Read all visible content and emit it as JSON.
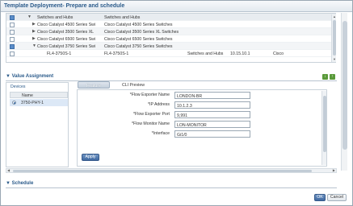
{
  "dialog": {
    "title": "Template Deployment- Prepare and schedule"
  },
  "tree": {
    "rows": [
      {
        "checked": true,
        "expanded": true,
        "indent": 1,
        "name": "Switches and Hubs",
        "type": "Switches and Hubs",
        "category": "",
        "ip": "",
        "vendor": ""
      },
      {
        "checked": false,
        "expanded": false,
        "indent": 2,
        "name": "Cisco Catalyst 4500 Series Swi",
        "type": "Cisco Catalyst 4500 Series Switches",
        "category": "",
        "ip": "",
        "vendor": ""
      },
      {
        "checked": false,
        "expanded": false,
        "indent": 2,
        "name": "Cisco Catalyst 3500 Series XL",
        "type": "Cisco Catalyst 3500 Series XL Switches",
        "category": "",
        "ip": "",
        "vendor": ""
      },
      {
        "checked": false,
        "expanded": false,
        "indent": 2,
        "name": "Cisco Catalyst 6500 Series Swi",
        "type": "Cisco Catalyst 6500 Series Switches",
        "category": "",
        "ip": "",
        "vendor": ""
      },
      {
        "checked": true,
        "expanded": true,
        "indent": 2,
        "name": "Cisco Catalyst 3750 Series Swi",
        "type": "Cisco Catalyst 3750 Series Switches",
        "category": "",
        "ip": "",
        "vendor": ""
      },
      {
        "checked": false,
        "expanded": null,
        "indent": 3,
        "name": "FL4-3750S-1",
        "type": "FL4-3750S-1",
        "category": "Switches and Hubs",
        "ip": "10.15.10.1",
        "vendor": "Cisco"
      }
    ]
  },
  "value_assignment": {
    "title": "Value Assignment",
    "devices_label": "Devices",
    "devices_column": "Name",
    "selected_device": "3750-PHY-1",
    "tabs": {
      "active": "Feature",
      "other": "CLI Preview"
    },
    "fields": [
      {
        "label": "*Flow Exporter Name",
        "value": "LONDON-BR"
      },
      {
        "label": "*IP Address",
        "value": "10.1.2.3"
      },
      {
        "label": "*Flow Exporter Port",
        "value": "9,991"
      },
      {
        "label": "*Flow Monitor Name",
        "value": "LON-MONITOR"
      },
      {
        "label": "*Interface",
        "value": "Gi1/0"
      }
    ],
    "apply_label": "Apply"
  },
  "schedule": {
    "title": "Schedule",
    "subtitle": ""
  },
  "footer": {
    "ok_label": "OK",
    "cancel_label": "Cancel"
  }
}
